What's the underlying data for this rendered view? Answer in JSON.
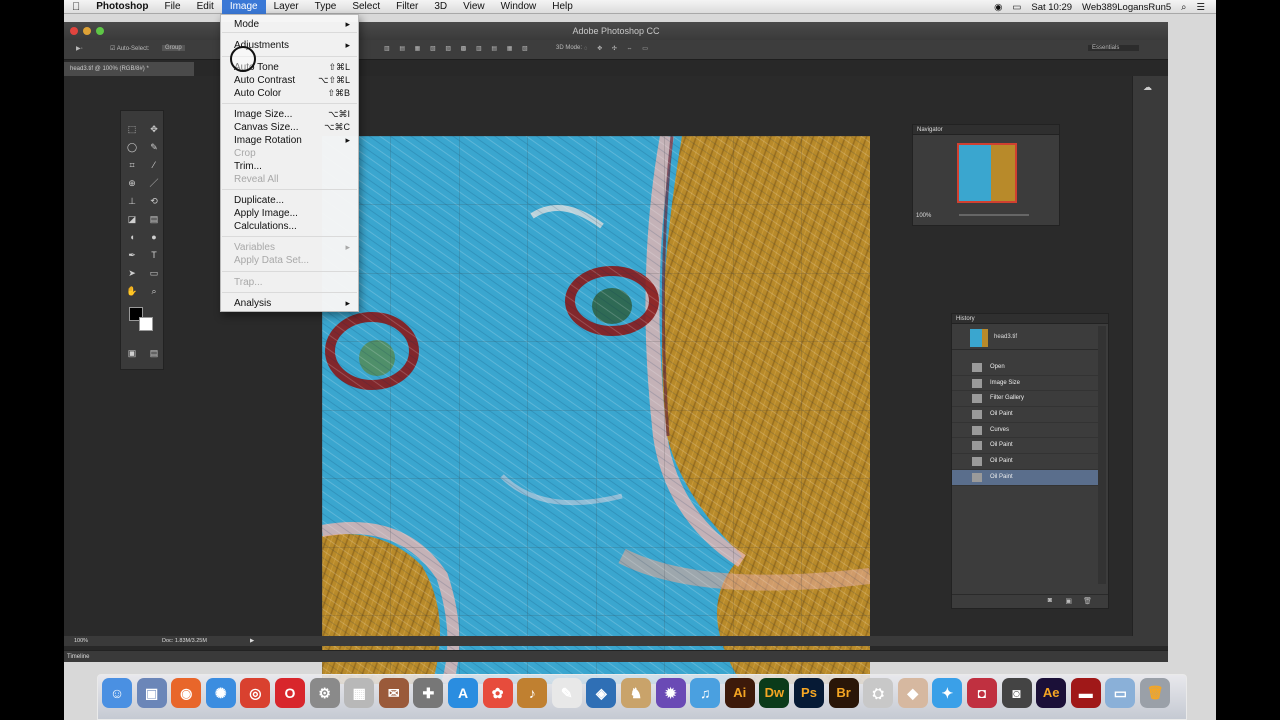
{
  "menubar": {
    "apple_icon": "apple-icon",
    "app_name": "Photoshop",
    "items": [
      "File",
      "Edit",
      "Image",
      "Layer",
      "Type",
      "Select",
      "Filter",
      "3D",
      "View",
      "Window",
      "Help"
    ],
    "active_item": "Image",
    "clock": "Sat 10:29",
    "user": "Web389LogansRun5"
  },
  "window": {
    "title": "Adobe Photoshop CC",
    "doc_tab": "head3.tif @ 100% (RGB/8#) *",
    "workspace": "Essentials",
    "options": {
      "auto_select": "Auto-Select:",
      "group": "Group",
      "mode_3d": "3D Mode:"
    }
  },
  "image_menu": {
    "items": [
      {
        "label": "Mode",
        "shortcut": "",
        "submenu": true,
        "disabled": false
      },
      {
        "label": "Adjustments",
        "shortcut": "",
        "submenu": true,
        "disabled": false
      },
      {
        "label": "Auto Tone",
        "shortcut": "⇧⌘L",
        "submenu": false,
        "disabled": false
      },
      {
        "label": "Auto Contrast",
        "shortcut": "⌥⇧⌘L",
        "submenu": false,
        "disabled": false
      },
      {
        "label": "Auto Color",
        "shortcut": "⇧⌘B",
        "submenu": false,
        "disabled": false
      },
      {
        "label": "Image Size...",
        "shortcut": "⌥⌘I",
        "submenu": false,
        "disabled": false
      },
      {
        "label": "Canvas Size...",
        "shortcut": "⌥⌘C",
        "submenu": false,
        "disabled": false
      },
      {
        "label": "Image Rotation",
        "shortcut": "",
        "submenu": true,
        "disabled": false
      },
      {
        "label": "Crop",
        "shortcut": "",
        "submenu": false,
        "disabled": true
      },
      {
        "label": "Trim...",
        "shortcut": "",
        "submenu": false,
        "disabled": false
      },
      {
        "label": "Reveal All",
        "shortcut": "",
        "submenu": false,
        "disabled": true
      },
      {
        "label": "Duplicate...",
        "shortcut": "",
        "submenu": false,
        "disabled": false
      },
      {
        "label": "Apply Image...",
        "shortcut": "",
        "submenu": false,
        "disabled": false
      },
      {
        "label": "Calculations...",
        "shortcut": "",
        "submenu": false,
        "disabled": false
      },
      {
        "label": "Variables",
        "shortcut": "",
        "submenu": true,
        "disabled": true
      },
      {
        "label": "Apply Data Set...",
        "shortcut": "",
        "submenu": false,
        "disabled": true
      },
      {
        "label": "Trap...",
        "shortcut": "",
        "submenu": false,
        "disabled": true
      },
      {
        "label": "Analysis",
        "shortcut": "",
        "submenu": true,
        "disabled": false
      }
    ]
  },
  "navigator": {
    "title": "Navigator",
    "zoom": "100%"
  },
  "history": {
    "title": "History",
    "snapshot": "head3.tif",
    "items": [
      "Open",
      "Image Size",
      "Filter Gallery",
      "Oil Paint",
      "Curves",
      "Oil Paint",
      "Oil Paint",
      "Oil Paint"
    ],
    "selected_index": 7
  },
  "status": {
    "zoom": "100%",
    "doc": "Doc: 1.83M/3.25M"
  },
  "timeline": "Timeline",
  "dock_apps": [
    {
      "name": "finder",
      "color": "#4a90e2",
      "glyph": "☺"
    },
    {
      "name": "preview",
      "color": "#6b86b8",
      "glyph": "▣"
    },
    {
      "name": "firefox",
      "color": "#e8662a",
      "glyph": "◉"
    },
    {
      "name": "safari",
      "color": "#3b8de0",
      "glyph": "✺"
    },
    {
      "name": "chrome",
      "color": "#d9412f",
      "glyph": "◎"
    },
    {
      "name": "opera",
      "color": "#d8262c",
      "glyph": "O"
    },
    {
      "name": "system-utility",
      "color": "#8a8a8a",
      "glyph": "⚙"
    },
    {
      "name": "photo-booth",
      "color": "#b8b8b8",
      "glyph": "▦"
    },
    {
      "name": "stamps",
      "color": "#9a5a3a",
      "glyph": "✉"
    },
    {
      "name": "disk-utility",
      "color": "#777",
      "glyph": "✚"
    },
    {
      "name": "app-store",
      "color": "#2a8de0",
      "glyph": "A"
    },
    {
      "name": "color-picker",
      "color": "#e74c3c",
      "glyph": "✿"
    },
    {
      "name": "guitar",
      "color": "#c08030",
      "glyph": "♪"
    },
    {
      "name": "notes",
      "color": "#e8e8e8",
      "glyph": "✎"
    },
    {
      "name": "network",
      "color": "#2f6fb5",
      "glyph": "◈"
    },
    {
      "name": "chess",
      "color": "#c9a36a",
      "glyph": "♞"
    },
    {
      "name": "color-wheel",
      "color": "#6a4ab5",
      "glyph": "✹"
    },
    {
      "name": "itunes",
      "color": "#4aa0e0",
      "glyph": "♫"
    },
    {
      "name": "illustrator",
      "color": "#3d1a0a",
      "glyph": "Ai"
    },
    {
      "name": "dreamweaver",
      "color": "#0b3b1a",
      "glyph": "Dw"
    },
    {
      "name": "photoshop",
      "color": "#061a35",
      "glyph": "Ps"
    },
    {
      "name": "bridge",
      "color": "#2a1608",
      "glyph": "Br"
    },
    {
      "name": "acrobat",
      "color": "#c8c8c8",
      "glyph": "⛭"
    },
    {
      "name": "photos",
      "color": "#d6b8a0",
      "glyph": "◆"
    },
    {
      "name": "twitter",
      "color": "#3aa0e8",
      "glyph": "✦"
    },
    {
      "name": "screen-capture",
      "color": "#c03040",
      "glyph": "◘"
    },
    {
      "name": "camera",
      "color": "#444",
      "glyph": "◙"
    },
    {
      "name": "after-effects",
      "color": "#1b1038",
      "glyph": "Ae"
    },
    {
      "name": "red-app",
      "color": "#a01818",
      "glyph": "▬"
    },
    {
      "name": "downloads-folder",
      "color": "#8ab0d8",
      "glyph": "▭"
    },
    {
      "name": "trash",
      "color": "#9aa0a8",
      "glyph": "🗑"
    }
  ]
}
